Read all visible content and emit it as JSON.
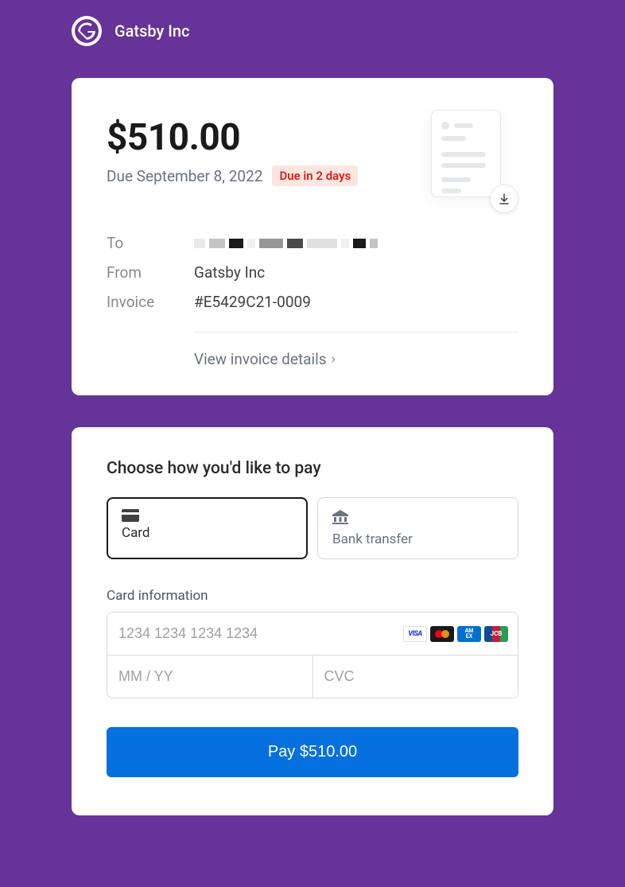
{
  "header": {
    "company_name": "Gatsby Inc"
  },
  "invoice": {
    "amount": "$510.00",
    "due_date": "Due September 8, 2022",
    "due_badge": "Due in 2 days",
    "to_label": "To",
    "from_label": "From",
    "from_value": "Gatsby Inc",
    "invoice_label": "Invoice",
    "invoice_value": "#E5429C21-0009",
    "view_details": "View invoice details"
  },
  "payment": {
    "heading": "Choose how you'd like to pay",
    "method_card": "Card",
    "method_bank": "Bank transfer",
    "card_section_label": "Card information",
    "card_number_placeholder": "1234 1234 1234 1234",
    "expiry_placeholder": "MM / YY",
    "cvc_placeholder": "CVC",
    "pay_button": "Pay $510.00",
    "brands": {
      "visa": "VISA",
      "amex": "AM\nEX",
      "jcb": "JCB"
    }
  }
}
